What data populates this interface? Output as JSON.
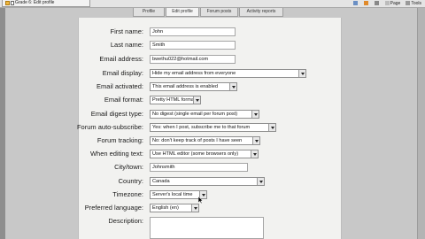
{
  "browser": {
    "tab_title": "Grade 6: Edit profile",
    "tools": [
      "Page",
      "Tools"
    ]
  },
  "tabs": [
    {
      "label": "Profile",
      "active": false
    },
    {
      "label": "Edit profile",
      "active": true
    },
    {
      "label": "Forum posts",
      "active": false
    },
    {
      "label": "Activity reports",
      "active": false
    }
  ],
  "form": {
    "first_name": {
      "label": "First name:",
      "value": "John"
    },
    "last_name": {
      "label": "Last name:",
      "value": "Smith"
    },
    "email": {
      "label": "Email address:",
      "value": "bwethu022@hotmail.com"
    },
    "email_display": {
      "label": "Email display:",
      "value": "Hide my email address from everyone"
    },
    "email_activated": {
      "label": "Email activated:",
      "value": "This email address is enabled"
    },
    "email_format": {
      "label": "Email format:",
      "value": "Pretty HTML format"
    },
    "email_digest": {
      "label": "Email digest type:",
      "value": "No digest (single email per forum post)"
    },
    "forum_autosub": {
      "label": "Forum auto-subscribe:",
      "value": "Yes: when I post, subscribe me to that forum"
    },
    "forum_tracking": {
      "label": "Forum tracking:",
      "value": "No: don't keep track of posts I have seen"
    },
    "editing_text": {
      "label": "When editing text:",
      "value": "Use HTML editor (some browsers only)"
    },
    "city": {
      "label": "City/town:",
      "value": "Johnsmith"
    },
    "country": {
      "label": "Country:",
      "value": "Canada"
    },
    "timezone": {
      "label": "Timezone:",
      "value": "Server's local time"
    },
    "language": {
      "label": "Preferred language:",
      "value": "English (en)"
    },
    "description": {
      "label": "Description:"
    }
  },
  "colors": {
    "page_bg": "#c8c8c8",
    "panel_bg": "#f2f2f0",
    "field_border": "#a5a5a5"
  }
}
